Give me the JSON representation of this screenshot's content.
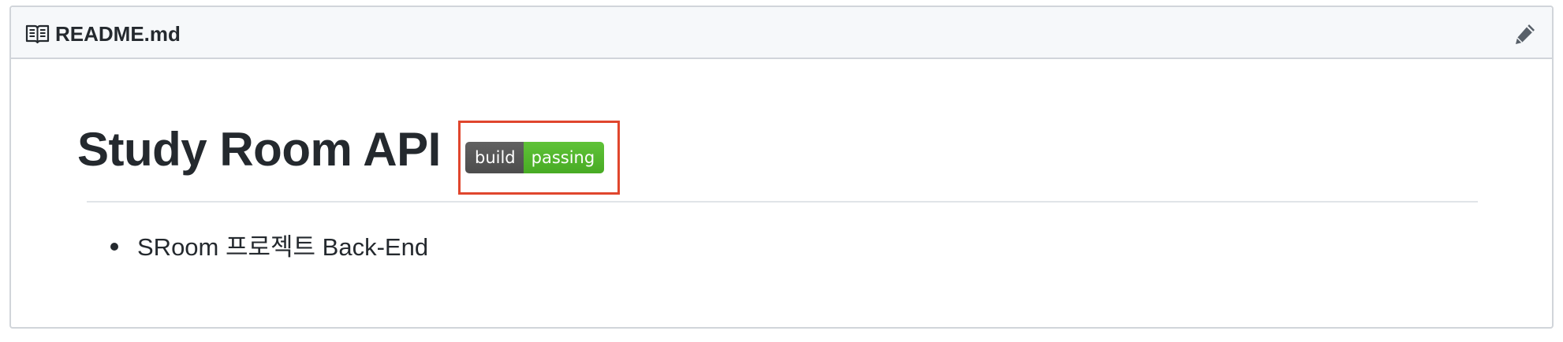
{
  "readme": {
    "file_name": "README.md",
    "title": "Study Room API",
    "badge": {
      "label": "build",
      "status": "passing",
      "label_color": "#555555",
      "status_color": "#4c1"
    },
    "list_items": [
      "SRoom 프로젝트 Back-End"
    ]
  },
  "icons": {
    "header": "book-icon",
    "edit": "pencil-icon"
  },
  "highlight_color": "#e0462d"
}
